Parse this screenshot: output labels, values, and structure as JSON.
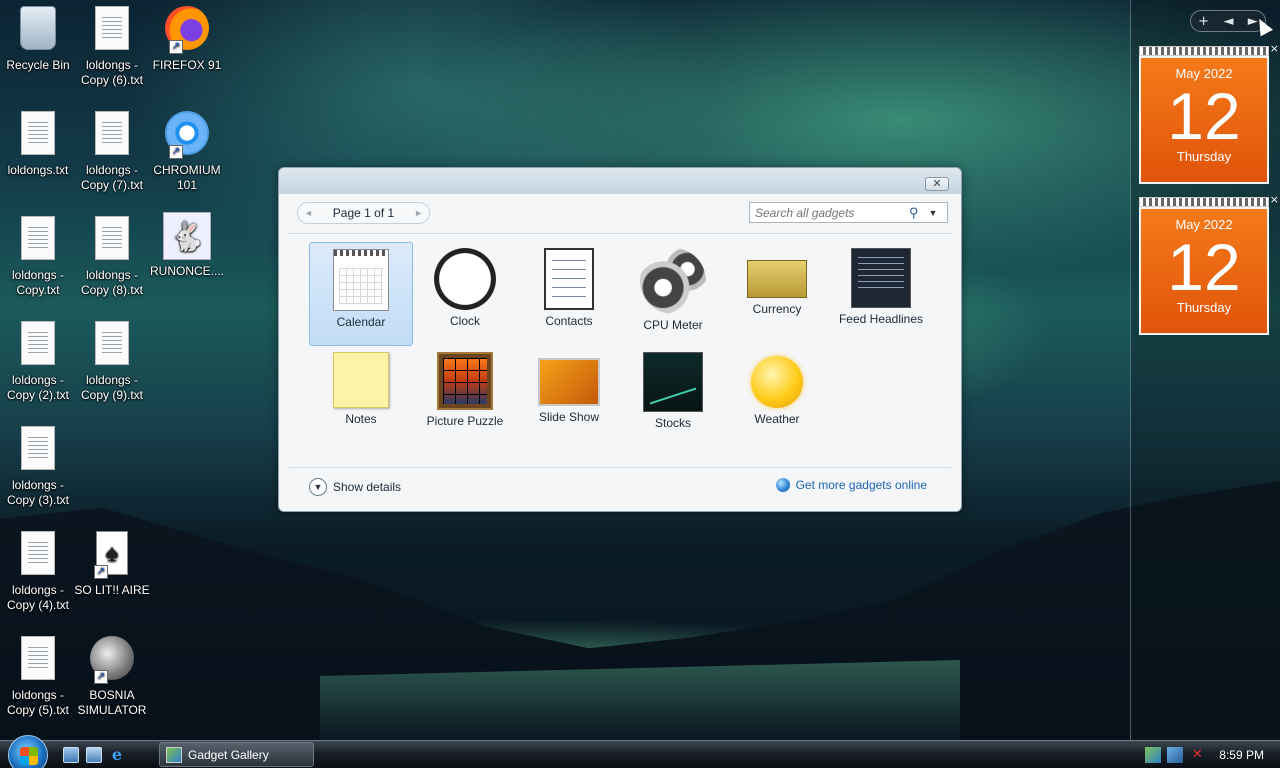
{
  "desktop": {
    "icons": [
      {
        "label": "Recycle Bin",
        "icon": "recycle-bin-icon"
      },
      {
        "label": "loldongs - Copy (6).txt",
        "icon": "text-file-icon"
      },
      {
        "label": "FIREFOX 91",
        "icon": "firefox-icon"
      },
      {
        "label": "loldongs.txt",
        "icon": "text-file-icon"
      },
      {
        "label": "loldongs - Copy (7).txt",
        "icon": "text-file-icon"
      },
      {
        "label": "CHROMIUM 101",
        "icon": "chromium-icon"
      },
      {
        "label": "loldongs - Copy.txt",
        "icon": "text-file-icon"
      },
      {
        "label": "loldongs - Copy (8).txt",
        "icon": "text-file-icon"
      },
      {
        "label": "RUNONCE....",
        "icon": "bunny-icon"
      },
      {
        "label": "loldongs - Copy (2).txt",
        "icon": "text-file-icon"
      },
      {
        "label": "loldongs - Copy (9).txt",
        "icon": "text-file-icon"
      },
      {
        "label": "loldongs - Copy (3).txt",
        "icon": "text-file-icon"
      },
      {
        "label": "loldongs - Copy (4).txt",
        "icon": "text-file-icon"
      },
      {
        "label": "SO LIT!! AIRE",
        "icon": "solitaire-cards-icon"
      },
      {
        "label": "loldongs - Copy (5).txt",
        "icon": "text-file-icon"
      },
      {
        "label": "BOSNIA SIMULATOR",
        "icon": "minesweeper-mine-icon"
      }
    ]
  },
  "sidebar": {
    "controls": {
      "add": "+",
      "prev": "◄",
      "next": "►"
    },
    "calendars": [
      {
        "month": "May 2022",
        "day": "12",
        "weekday": "Thursday"
      },
      {
        "month": "May 2022",
        "day": "12",
        "weekday": "Thursday"
      }
    ]
  },
  "gallery": {
    "pager": {
      "label": "Page 1 of 1"
    },
    "search": {
      "placeholder": "Search all gadgets"
    },
    "gadgets": [
      {
        "name": "Calendar",
        "selected": true
      },
      {
        "name": "Clock"
      },
      {
        "name": "Contacts"
      },
      {
        "name": "CPU Meter"
      },
      {
        "name": "Currency"
      },
      {
        "name": "Feed Headlines"
      },
      {
        "name": "Notes"
      },
      {
        "name": "Picture Puzzle"
      },
      {
        "name": "Slide Show"
      },
      {
        "name": "Stocks"
      },
      {
        "name": "Weather"
      }
    ],
    "show_details": "Show details",
    "get_more": "Get more gadgets online"
  },
  "taskbar": {
    "task": "Gadget Gallery",
    "clock": "8:59 PM"
  }
}
